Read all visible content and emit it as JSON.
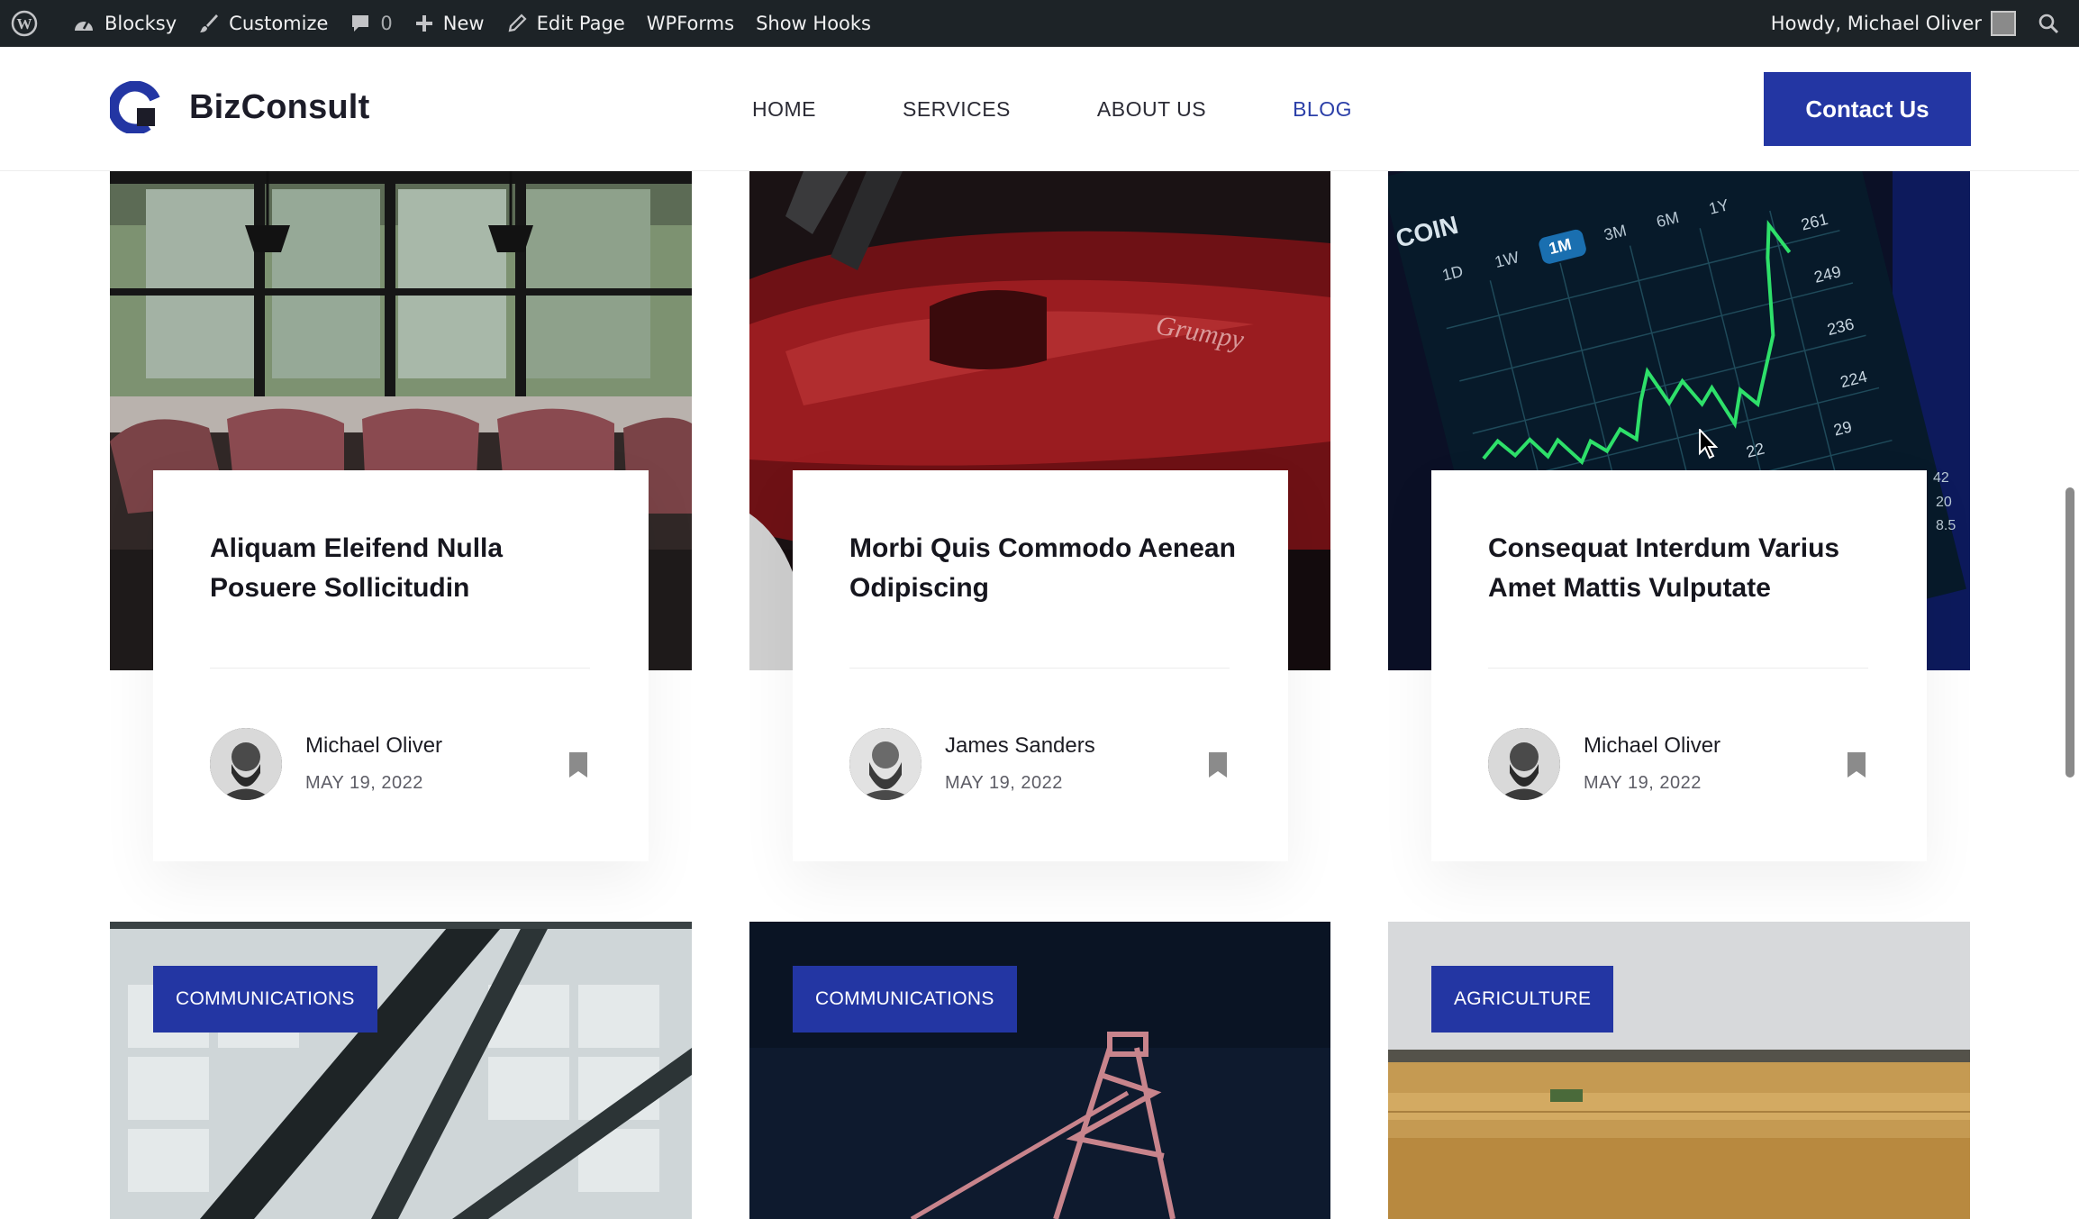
{
  "admin_bar": {
    "site_name": "Blocksy",
    "customize": "Customize",
    "comments_count": "0",
    "new": "New",
    "edit_page": "Edit Page",
    "wpforms": "WPForms",
    "show_hooks": "Show Hooks",
    "howdy": "Howdy, Michael Oliver"
  },
  "header": {
    "brand": "BizConsult",
    "nav": [
      "HOME",
      "SERVICES",
      "ABOUT US",
      "BLOG"
    ],
    "active_nav": "BLOG",
    "cta": "Contact Us"
  },
  "colors": {
    "accent": "#2336a3",
    "admin_bar": "#1d2327"
  },
  "posts": [
    {
      "title": "Aliquam Eleifend Nulla Posuere Sollicitudin",
      "author": "Michael Oliver",
      "date": "MAY 19, 2022",
      "image": "meeting-room-photo"
    },
    {
      "title": "Morbi Quis Commodo Aenean Odipiscing",
      "author": "James Sanders",
      "date": "MAY 19, 2022",
      "image": "red-airplane-photo"
    },
    {
      "title": "Consequat Interdum Varius Amet Mattis Vulputate",
      "author": "Michael Oliver",
      "date": "MAY 19, 2022",
      "image": "stock-chart-phone-photo"
    }
  ],
  "stock_chart": {
    "tabs": [
      "1D",
      "1W",
      "1M",
      "3M",
      "6M",
      "1Y"
    ],
    "selected_tab": "1M",
    "title_fragment": "COIN",
    "y_labels": [
      "261",
      "249",
      "236",
      "224",
      "29",
      "22"
    ],
    "edge_labels": [
      "42",
      "20",
      "8.5"
    ]
  },
  "next_posts": [
    {
      "category": "COMMUNICATIONS",
      "image": "glass-building-photo"
    },
    {
      "category": "COMMUNICATIONS",
      "image": "night-crane-photo"
    },
    {
      "category": "AGRICULTURE",
      "image": "wheat-field-photo"
    }
  ]
}
